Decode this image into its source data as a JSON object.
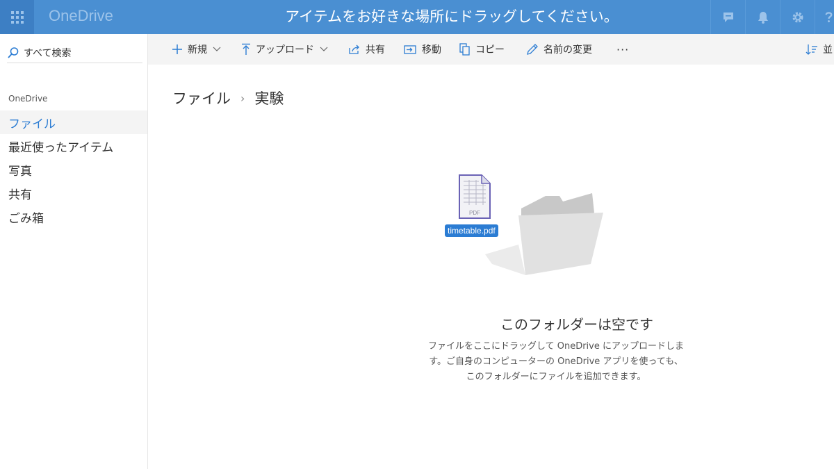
{
  "header": {
    "brand": "OneDrive",
    "banner": "アイテムをお好きな場所にドラッグしてください。",
    "icons": [
      "app-launcher-icon",
      "chat-icon",
      "bell-icon",
      "gear-icon",
      "help-icon"
    ],
    "colors": {
      "bar": "#4a8fd2",
      "launcher": "#3d7fc4"
    }
  },
  "sidebar": {
    "search_label": "すべて検索",
    "section_title": "OneDrive",
    "items": [
      {
        "label": "ファイル",
        "active": true
      },
      {
        "label": "最近使ったアイテム"
      },
      {
        "label": "写真"
      },
      {
        "label": "共有"
      },
      {
        "label": "ごみ箱"
      }
    ]
  },
  "commands": {
    "new": "新規",
    "upload": "アップロード",
    "share": "共有",
    "move": "移動",
    "copy": "コピー",
    "rename": "名前の変更",
    "more": "···",
    "sort": "並"
  },
  "breadcrumb": {
    "root": "ファイル",
    "current": "実験"
  },
  "drag_item": {
    "name": "timetable.pdf",
    "type_label": "PDF"
  },
  "empty_state": {
    "title": "このフォルダーは空です",
    "line1": "ファイルをここにドラッグして OneDrive にアップロードしま",
    "line2": "す。ご自身のコンピューターの OneDrive アプリを使っても、",
    "line3": "このフォルダーにファイルを追加できます。"
  },
  "accent_color": "#2b7cd3"
}
